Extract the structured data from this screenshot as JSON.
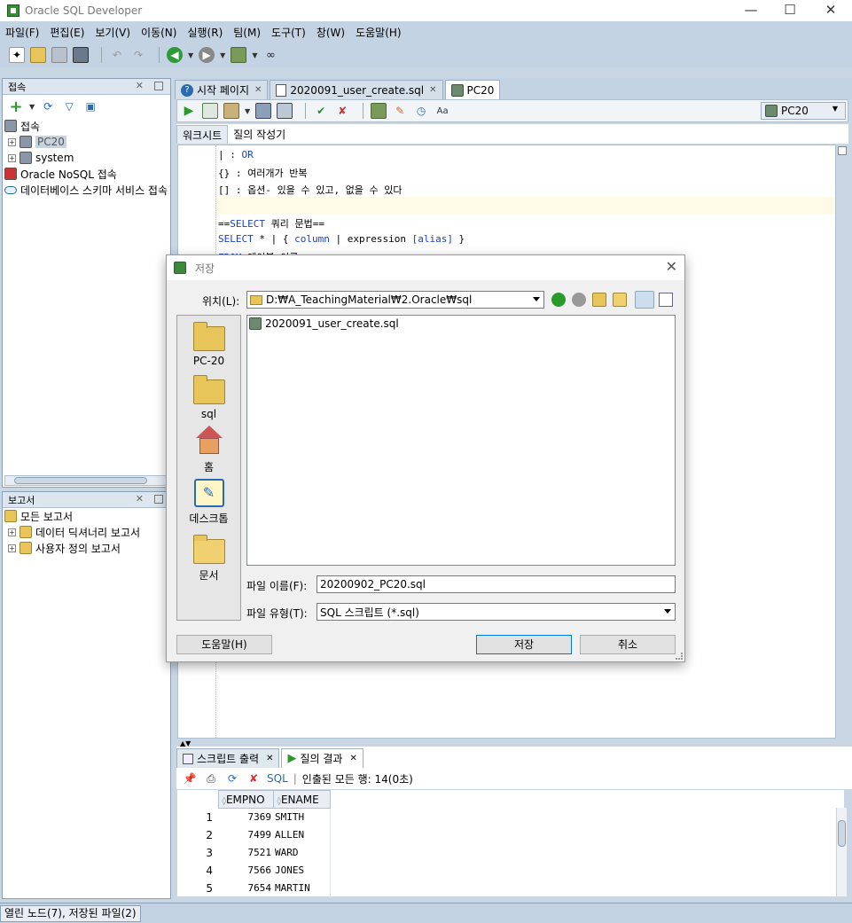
{
  "window": {
    "title": "Oracle SQL Developer",
    "min": "—",
    "max": "☐",
    "close": "✕"
  },
  "menu": [
    "파일(F)",
    "편집(E)",
    "보기(V)",
    "이동(N)",
    "실행(R)",
    "팀(M)",
    "도구(T)",
    "창(W)",
    "도움말(H)"
  ],
  "connections_panel": {
    "title": "접속",
    "root": "접속",
    "items": [
      "PC20",
      "system",
      "Oracle NoSQL 접속",
      "데이터베이스 스키마 서비스 접속"
    ]
  },
  "reports_panel": {
    "title": "보고서",
    "items": [
      "모든 보고서",
      "데이터 딕셔너리 보고서",
      "사용자 정의 보고서"
    ]
  },
  "editor_tabs": [
    {
      "label": "시작 페이지"
    },
    {
      "label": "2020091_user_create.sql"
    },
    {
      "label": "PC20"
    }
  ],
  "connection_selector": "PC20",
  "subtabs": [
    "워크시트",
    "질의 작성기"
  ],
  "code": {
    "line1_a": "| : ",
    "line1_b": "OR",
    "line2": "{} : 여러개가 반복",
    "line3": "[] : 옵션- 있을 수 있고, 없을 수 있다",
    "line5_a": "==",
    "line5_b": "SELECT",
    "line5_c": " 쿼리 문법==",
    "line6_a": "SELECT",
    "line6_b": " * | { ",
    "line6_c": "column",
    "line6_d": " | expression ",
    "line6_e": "[alias]",
    "line6_f": " }",
    "line7_a": "FROM",
    "line7_b": " 테이블 이름"
  },
  "dialog": {
    "title": "저장",
    "location_label": "위치(L):",
    "location_value": "D:₩A_TeachingMaterial₩2.Oracle₩sql",
    "places": [
      "PC-20",
      "sql",
      "홈",
      "데스크톱",
      "문서"
    ],
    "files": [
      "2020091_user_create.sql"
    ],
    "filename_label": "파일 이름(F):",
    "filename_value": "20200902_PC20.sql",
    "filetype_label": "파일 유형(T):",
    "filetype_value": "SQL 스크립트 (*.sql)",
    "help_button": "도움말(H)",
    "save_button": "저장",
    "cancel_button": "취소"
  },
  "bottom_tabs": [
    "스크립트 출력",
    "질의 결과"
  ],
  "result_toolbar": {
    "sql_label": "SQL",
    "fetched": "인출된 모든 행: 14(0초)"
  },
  "result_grid": {
    "columns": [
      "EMPNO",
      "ENAME"
    ],
    "rows": [
      [
        "1",
        "7369",
        "SMITH"
      ],
      [
        "2",
        "7499",
        "ALLEN"
      ],
      [
        "3",
        "7521",
        "WARD"
      ],
      [
        "4",
        "7566",
        "JONES"
      ],
      [
        "5",
        "7654",
        "MARTIN"
      ]
    ]
  },
  "status": "열린 노드(7), 저장된 파일(2)"
}
